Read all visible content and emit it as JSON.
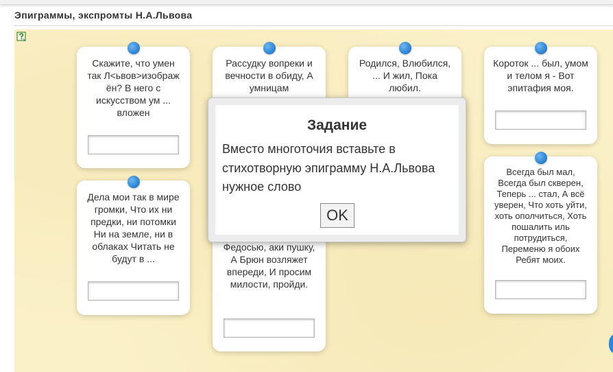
{
  "page": {
    "title": "Эпиграммы, экспромты Н.А.Львова"
  },
  "icons": {
    "help": "help-question-icon",
    "pin": "pushpin-icon"
  },
  "colors": {
    "board_background": "#fbf1c8",
    "pin_blue": "#2f86d6",
    "card_background": "#ffffff"
  },
  "cards": [
    {
      "text": "Скажите, что умен так Л<ьвов>изображ ён? В него с искусством ум ... вложен",
      "answer_value": ""
    },
    {
      "text": "Рассудку вопреки и вечности в обиду, А умницам",
      "answer_value": ""
    },
    {
      "text": "Родился, Влюбился, ... И жил, Пока любил.",
      "answer_value": ""
    },
    {
      "text": "Короток ... был, умом и телом я - Вот эпитафия моя.",
      "answer_value": ""
    },
    {
      "text": "Дела мои так в мире громки, Что их ни предки, ни потомки Ни на земле, ни в облаках Читать не будут в ...",
      "answer_value": ""
    },
    {
      "text": "Федосью, аки пушку, А Брюн возляжет впереди, И просим милости, пройди.",
      "answer_value": ""
    },
    {
      "text": "Всегда был мал, Всегда был скверен, Теперь ... стал, А всё уверен, Что хоть уйти, хоть ополчиться, Хоть пошалить иль потрудиться, Переменю я обоих Ребят моих.",
      "answer_value": ""
    }
  ],
  "modal": {
    "title": "Задание",
    "body": "Вместо многоточия вставьте в стихотворную эпиграмму Н.А.Львова нужное слово",
    "ok_label": "OK"
  }
}
